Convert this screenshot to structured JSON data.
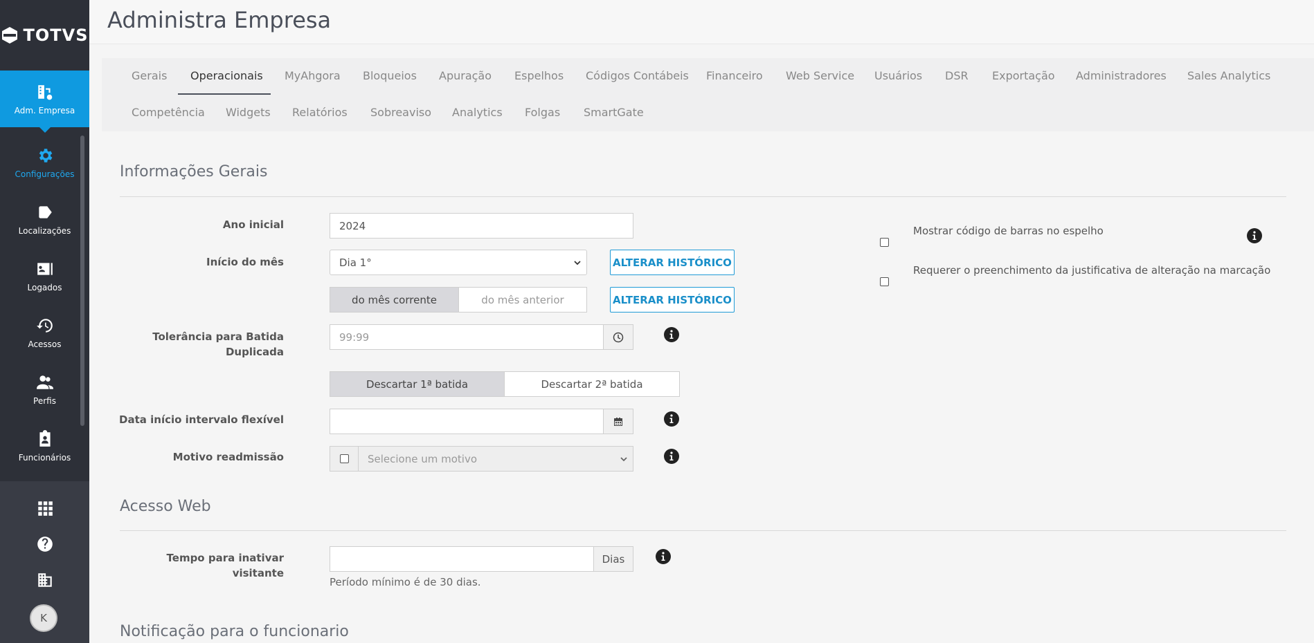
{
  "sidebar": {
    "brand": "TOTVS",
    "items": [
      {
        "label": "Adm. Empresa",
        "icon": "building-settings-icon"
      },
      {
        "label": "Configurações",
        "icon": "gear-icon"
      },
      {
        "label": "Localizações",
        "icon": "tag-icon"
      },
      {
        "label": "Logados",
        "icon": "id-card-icon"
      },
      {
        "label": "Acessos",
        "icon": "history-icon"
      },
      {
        "label": "Perfis",
        "icon": "users-icon"
      },
      {
        "label": "Funcionários",
        "icon": "clipboard-user-icon"
      }
    ],
    "bottom": [
      "apps-grid-icon",
      "help-icon",
      "building-icon"
    ],
    "avatar": "K"
  },
  "header": {
    "title": "Administra Empresa"
  },
  "tabs": {
    "row1": [
      "Gerais",
      "Operacionais",
      "MyAhgora",
      "Bloqueios",
      "Apuração",
      "Espelhos",
      "Códigos Contábeis",
      "Financeiro",
      "Web Service",
      "Usuários",
      "DSR",
      "Exportação",
      "Administradores",
      "Sales Analytics"
    ],
    "row2": [
      "Competência",
      "Widgets",
      "Relatórios",
      "Sobreaviso",
      "Analytics",
      "Folgas",
      "SmartGate"
    ],
    "active": "Operacionais"
  },
  "general": {
    "title": "Informações Gerais",
    "ano_inicial_label": "Ano inicial",
    "ano_inicial_value": "2024",
    "inicio_mes_label": "Início do mês",
    "inicio_mes_value": "Dia 1°",
    "alterar_historico": "ALTERAR HISTÓRICO",
    "seg_mes_corrente": "do mês corrente",
    "seg_mes_anterior": "do mês anterior",
    "tolerancia_label_1": "Tolerância para Batida",
    "tolerancia_label_2": "Duplicada",
    "tolerancia_placeholder": "99:99",
    "seg_descartar_1": "Descartar 1ª batida",
    "seg_descartar_2": "Descartar 2ª batida",
    "data_intervalo_label": "Data início intervalo flexível",
    "motivo_label": "Motivo readmissão",
    "motivo_placeholder": "Selecione um motivo",
    "chk_codigo_barras": "Mostrar código de barras no espelho",
    "chk_justificativa": "Requerer o preenchimento da justificativa de alteração na marcação"
  },
  "web": {
    "title": "Acesso Web",
    "tempo_label": "Tempo para inativar visitante",
    "tempo_addon": "Dias",
    "help": "Período mínimo é de 30 dias."
  },
  "notify": {
    "title": "Notificação para o funcionario"
  }
}
